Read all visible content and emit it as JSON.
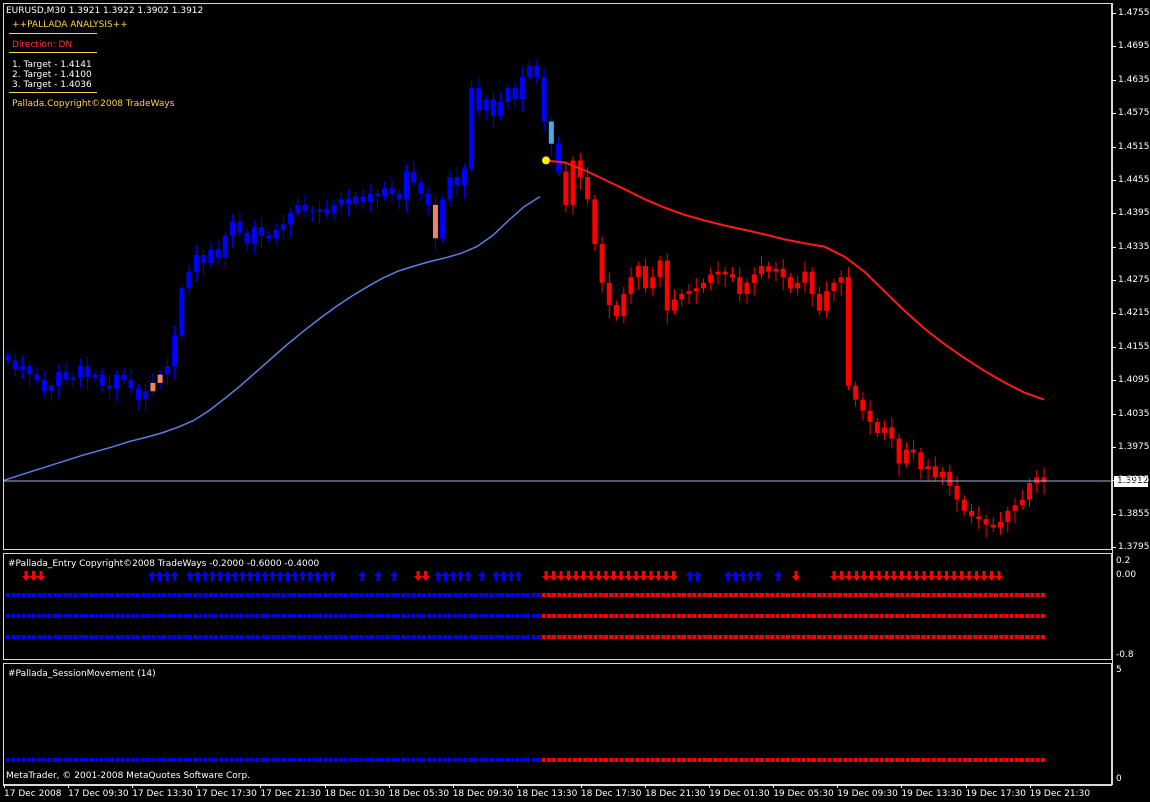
{
  "symbol_header": "EURUSD,M30  1.3921 1.3922 1.3902 1.3912",
  "pallada": {
    "title": "++PALLADA ANALYSIS++",
    "direction": "Direction: DN",
    "targets": [
      "1. Target - 1.4141",
      "2. Target - 1.4100",
      "3. Target - 1.4036"
    ],
    "copyright": "Pallada.Copyright©2008 TradeWays"
  },
  "current_price": "1.3912",
  "entry_indicator": {
    "label": "#Pallada_Entry Copyright©2008 TradeWays -0.2000 -0.6000 -0.4000",
    "scale": [
      "0.2",
      "0.00",
      "-0.8"
    ]
  },
  "session_indicator": {
    "label": "#Pallada_SessionMovement (14)",
    "scale": [
      "5",
      "0"
    ]
  },
  "footer_copyright": "MetaTrader, © 2001-2008 MetaQuotes Software Corp.",
  "colors": {
    "bull_blue": "#0000ff",
    "bear_red": "#ff0000",
    "ma_blue": "#5b7fe8",
    "ma_red": "#ff1a1a",
    "highlight_salmon": "#f08070",
    "highlight_cyan": "#4aa8f0",
    "text_yellow": "#ffd24d",
    "text_red": "#ff3030"
  },
  "chart_data": {
    "type": "candlestick",
    "price_ticks": [
      "1.4755",
      "1.4695",
      "1.4635",
      "1.4575",
      "1.4515",
      "1.4455",
      "1.4395",
      "1.4335",
      "1.4275",
      "1.4215",
      "1.4155",
      "1.4095",
      "1.4035",
      "1.3975",
      "1.3915",
      "1.3855",
      "1.3795"
    ],
    "time_ticks": [
      "17 Dec 2008",
      "17 Dec 09:30",
      "17 Dec 13:30",
      "17 Dec 17:30",
      "17 Dec 21:30",
      "18 Dec 01:30",
      "18 Dec 05:30",
      "18 Dec 09:30",
      "18 Dec 13:30",
      "18 Dec 17:30",
      "18 Dec 21:30",
      "19 Dec 01:30",
      "19 Dec 05:30",
      "19 Dec 09:30",
      "19 Dec 13:30",
      "19 Dec 17:30",
      "19 Dec 21:30"
    ],
    "closes": [
      1.413,
      1.4115,
      1.412,
      1.4105,
      1.4095,
      1.4075,
      1.4085,
      1.411,
      1.4095,
      1.41,
      1.412,
      1.41,
      1.4105,
      1.4085,
      1.408,
      1.4105,
      1.4095,
      1.408,
      1.406,
      1.4075,
      1.409,
      1.4105,
      1.412,
      1.4175,
      1.426,
      1.429,
      1.432,
      1.4305,
      1.433,
      1.4315,
      1.4355,
      1.438,
      1.436,
      1.434,
      1.437,
      1.4355,
      1.435,
      1.4365,
      1.4375,
      1.4395,
      1.441,
      1.44,
      1.4398,
      1.4402,
      1.4395,
      1.441,
      1.442,
      1.4412,
      1.4425,
      1.4415,
      1.443,
      1.4425,
      1.444,
      1.443,
      1.442,
      1.447,
      1.445,
      1.443,
      1.441,
      1.435,
      1.442,
      1.446,
      1.4445,
      1.4475,
      1.462,
      1.458,
      1.46,
      1.457,
      1.4595,
      1.462,
      1.46,
      1.464,
      1.466,
      1.464,
      1.456,
      1.452,
      1.447,
      1.441,
      1.449,
      1.446,
      1.442,
      1.434,
      1.427,
      1.423,
      1.421,
      1.425,
      1.428,
      1.43,
      1.426,
      1.428,
      1.431,
      1.422,
      1.424,
      1.425,
      1.4255,
      1.426,
      1.427,
      1.4285,
      1.429,
      1.4285,
      1.428,
      1.425,
      1.427,
      1.4285,
      1.43,
      1.429,
      1.4295,
      1.428,
      1.426,
      1.427,
      1.429,
      1.425,
      1.422,
      1.4255,
      1.427,
      1.428,
      1.4085,
      1.406,
      1.404,
      1.402,
      1.4,
      1.401,
      1.399,
      1.3945,
      1.397,
      1.3965,
      1.3935,
      1.394,
      1.392,
      1.393,
      1.3905,
      1.388,
      1.386,
      1.385,
      1.3845,
      1.3835,
      1.383,
      1.384,
      1.386,
      1.387,
      1.388,
      1.391,
      1.392,
      1.3912
    ],
    "ma_blue": [
      1.3915,
      1.3924,
      1.3933,
      1.3942,
      1.3951,
      1.396,
      1.3968,
      1.3976,
      1.3985,
      1.3992,
      1.4,
      1.401,
      1.4022,
      1.404,
      1.4062,
      1.4085,
      1.411,
      1.4135,
      1.416,
      1.4183,
      1.4205,
      1.4226,
      1.4245,
      1.4262,
      1.4278,
      1.4291,
      1.43,
      1.4308,
      1.4315,
      1.4323,
      1.4335,
      1.4355,
      1.4382,
      1.4407,
      1.4425
    ],
    "ma_red": [
      1.449,
      1.4486,
      1.4472,
      1.4455,
      1.4438,
      1.442,
      1.4405,
      1.4392,
      1.4382,
      1.4373,
      1.4365,
      1.4357,
      1.4348,
      1.4341,
      1.4335,
      1.4317,
      1.429,
      1.4255,
      1.422,
      1.4188,
      1.416,
      1.4135,
      1.4112,
      1.4091,
      1.4073,
      1.406
    ]
  }
}
